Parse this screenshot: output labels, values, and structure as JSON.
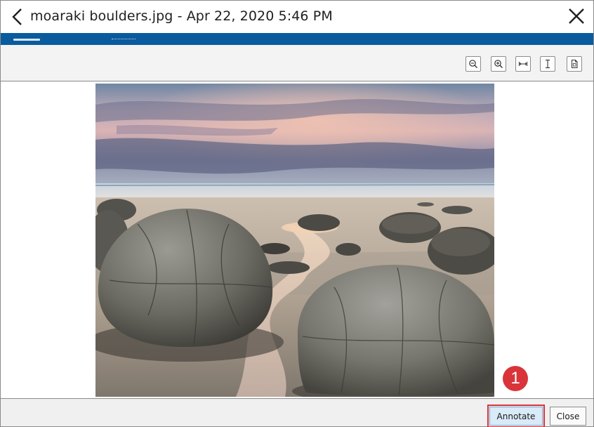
{
  "window": {
    "title": "moaraki boulders.jpg - Apr 22, 2020 5:46 PM"
  },
  "icons": {
    "back": "chevron-left-icon",
    "close": "close-icon",
    "zoom_out": "zoom-out-icon",
    "zoom_in": "zoom-in-icon",
    "fit_width": "fit-width-icon",
    "fit_height": "fit-height-icon",
    "actual_size": "actual-size-icon"
  },
  "footer": {
    "annotate_label": "Annotate",
    "close_label": "Close"
  },
  "callout": {
    "number": "1"
  },
  "colors": {
    "tab_strip": "#0a5b9e",
    "annotate_button": "#d9ebf8",
    "highlight": "#d9343a"
  }
}
